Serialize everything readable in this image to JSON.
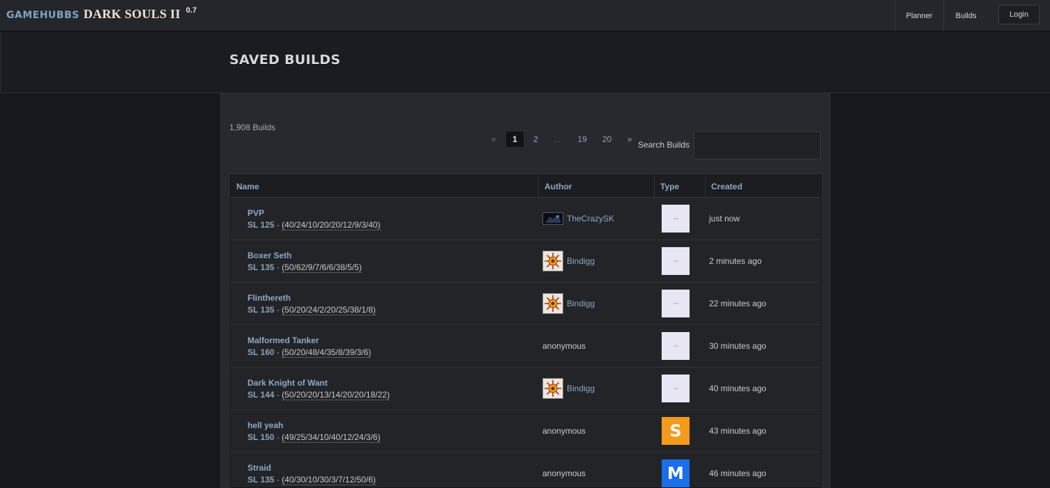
{
  "brand": {
    "gamehubs": "GAMEHUBBS",
    "game": "DARK SOULS II",
    "version": "0.7"
  },
  "nav": {
    "planner": "Planner",
    "builds": "Builds",
    "login": "Login"
  },
  "page": {
    "title": "SAVED BUILDS"
  },
  "list": {
    "count_text": "1,908 Builds"
  },
  "pagination": {
    "prev": "«",
    "pages": [
      "1",
      "2",
      "...",
      "19",
      "20"
    ],
    "active_page": "1",
    "next": "»"
  },
  "search": {
    "label": "Search Builds",
    "value": "",
    "placeholder": ""
  },
  "table": {
    "headers": {
      "name": "Name",
      "author": "Author",
      "type": "Type",
      "created": "Created"
    },
    "rows": [
      {
        "name": "PVP",
        "sl_label": "SL 125",
        "sep": " - ",
        "stats": "(40/24/10/20/20/12/9/3/40)",
        "author": "TheCrazySK",
        "author_avatar": "dark-banner",
        "type_letter": "",
        "type_color": "#e8e6f2",
        "created": "just now"
      },
      {
        "name": "Boxer Seth",
        "sl_label": "SL 135",
        "sep": " - ",
        "stats": "(50/62/9/7/6/6/38/5/5)",
        "author": "Bindigg",
        "author_avatar": "sun-emblem",
        "type_letter": "",
        "type_color": "#e8e6f2",
        "created": "2 minutes ago"
      },
      {
        "name": "Flinthereth",
        "sl_label": "SL 135",
        "sep": " - ",
        "stats": "(50/20/24/2/20/25/38/1/8)",
        "author": "Bindigg",
        "author_avatar": "sun-emblem",
        "type_letter": "",
        "type_color": "#e8e6f2",
        "created": "22 minutes ago"
      },
      {
        "name": "Malformed Tanker",
        "sl_label": "SL 160",
        "sep": " - ",
        "stats": "(50/20/48/4/35/8/39/3/6)",
        "author": "anonymous",
        "author_avatar": "",
        "type_letter": "",
        "type_color": "#e8e6f2",
        "created": "30 minutes ago"
      },
      {
        "name": "Dark Knight of Want",
        "sl_label": "SL 144",
        "sep": " - ",
        "stats": "(50/20/20/13/14/20/20/18/22)",
        "author": "Bindigg",
        "author_avatar": "sun-emblem",
        "type_letter": "",
        "type_color": "#e8e6f2",
        "created": "40 minutes ago"
      },
      {
        "name": "hell yeah",
        "sl_label": "SL 150",
        "sep": " - ",
        "stats": "(49/25/34/10/40/12/24/3/6)",
        "author": "anonymous",
        "author_avatar": "",
        "type_letter": "S",
        "type_color": "#f49a1c",
        "created": "43 minutes ago"
      },
      {
        "name": "Straid",
        "sl_label": "SL 135",
        "sep": " - ",
        "stats": "(40/30/10/30/3/7/12/50/6)",
        "author": "anonymous",
        "author_avatar": "",
        "type_letter": "M",
        "type_color": "#1a6ee8",
        "created": "46 minutes ago"
      }
    ]
  },
  "colors": {
    "accent": "#8fa9c4",
    "background": "#16181d",
    "panel": "#27292e"
  }
}
